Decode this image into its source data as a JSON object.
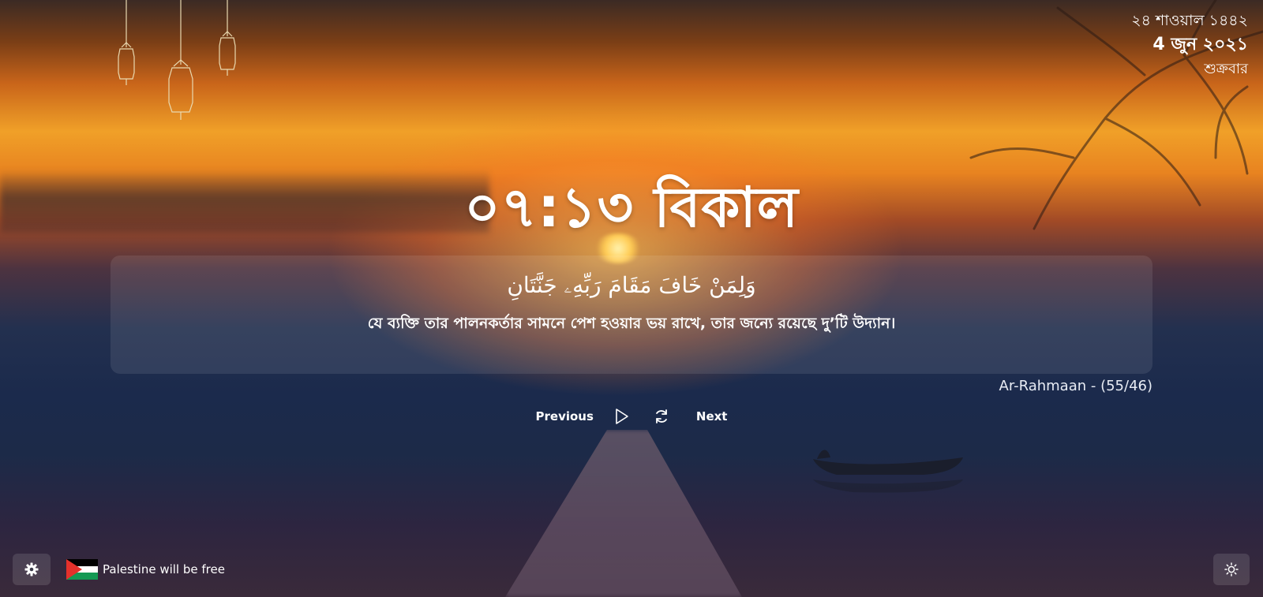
{
  "date": {
    "hijri": "২৪ শাওয়াল ১৪৪২",
    "gregorian": "4 জুন ২০২১",
    "weekday": "শুক্রবার"
  },
  "clock": {
    "time": "০৭:১৩ বিকাল"
  },
  "verse": {
    "arabic": "وَلِمَنْ خَافَ مَقَامَ رَبِّهِۦ جَنَّتَانِ",
    "translation": "যে ব্যক্তি তার পালনকর্তার সামনে পেশ হওয়ার ভয় রাখে, তার জন্যে রয়েছে দু’টি উদ্যান।",
    "reference": "Ar-Rahmaan - (55/46)"
  },
  "controls": {
    "previous_label": "Previous",
    "next_label": "Next",
    "play_icon": "play-icon",
    "refresh_icon": "refresh-icon"
  },
  "footer": {
    "settings_icon": "gear-icon",
    "flag_icon": "palestine-flag-icon",
    "palestine_text": "Palestine will be free",
    "theme_icon": "sun-icon"
  }
}
